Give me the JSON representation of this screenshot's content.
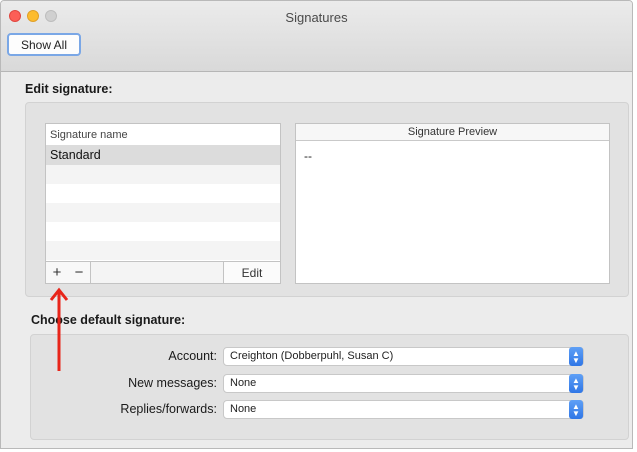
{
  "window": {
    "title": "Signatures",
    "toolbar": {
      "show_all_label": "Show All"
    }
  },
  "edit_section": {
    "heading": "Edit signature:",
    "list": {
      "column_header": "Signature name",
      "items": [
        "Standard",
        "",
        "",
        "",
        "",
        ""
      ],
      "selected_index": 0
    },
    "footer": {
      "add_label": "+",
      "remove_label": "−",
      "edit_label": "Edit"
    },
    "preview": {
      "header": "Signature Preview",
      "body": "--"
    }
  },
  "default_section": {
    "heading": "Choose default signature:",
    "account": {
      "label": "Account:",
      "value": "Creighton (Dobberpuhl, Susan C)"
    },
    "new_messages": {
      "label": "New messages:",
      "value": "None"
    },
    "replies": {
      "label": "Replies/forwards:",
      "value": "None"
    }
  },
  "annotation": {
    "color": "#e8251a",
    "icon": "arrow-up-icon"
  },
  "colors": {
    "accent": "#2f76e6",
    "close": "#fc5f57",
    "minimize": "#fdbc2e"
  }
}
